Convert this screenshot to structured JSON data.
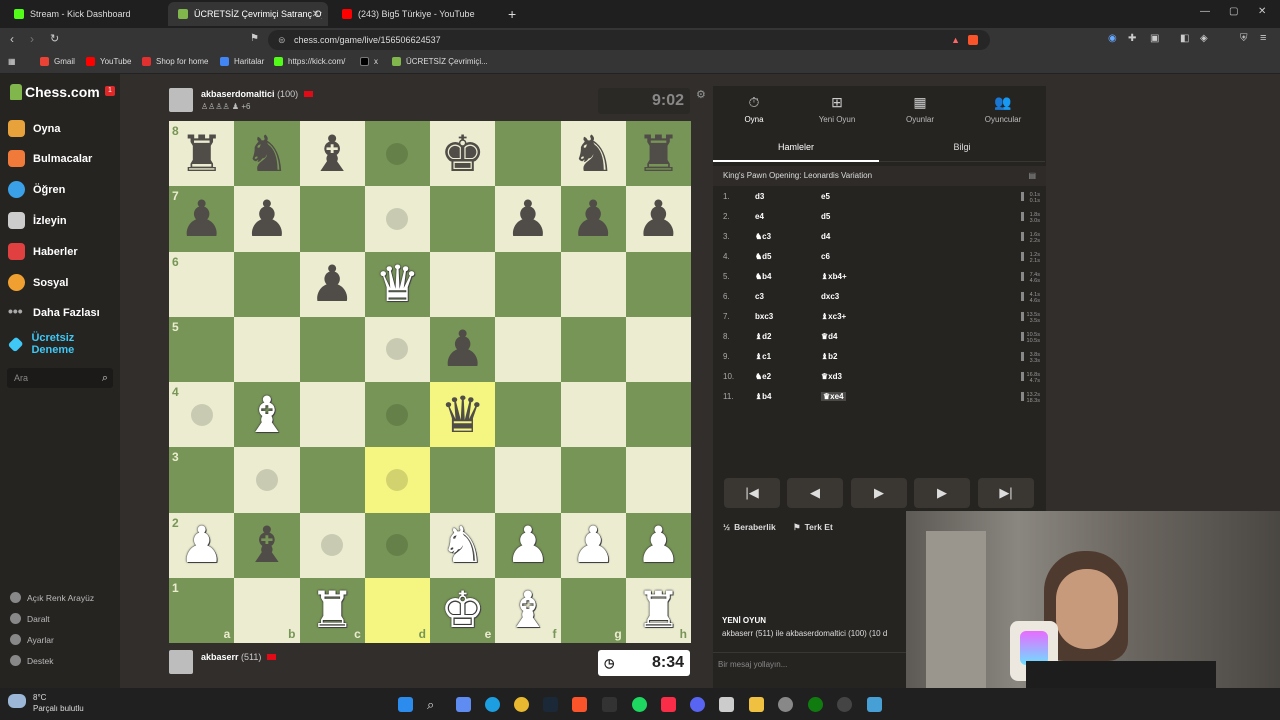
{
  "browser": {
    "tabs": [
      {
        "title": "Stream - Kick Dashboard",
        "color": "#53fc18"
      },
      {
        "title": "ÜCRETSİZ Çevrimiçi Satranç Oyn",
        "color": "#81b64c"
      },
      {
        "title": "(243) Big5 Türkiye - YouTube",
        "color": "#ff0000"
      }
    ],
    "url": "chess.com/game/live/156506624537",
    "bookmarks": [
      {
        "label": "Gmail",
        "color": "#ea4335"
      },
      {
        "label": "YouTube",
        "color": "#ff0000"
      },
      {
        "label": "Shop for home",
        "color": "#e03030"
      },
      {
        "label": "Haritalar",
        "color": "#4285f4"
      },
      {
        "label": "https://kick.com/",
        "color": "#53fc18"
      },
      {
        "label": "x",
        "color": "#000000"
      },
      {
        "label": "ÜCRETSİZ Çevrimiçi...",
        "color": "#81b64c"
      }
    ]
  },
  "sidebar": {
    "logo": "Chess.com",
    "notif_count": "1",
    "items": [
      {
        "label": "Oyna",
        "color": "#e8a23b"
      },
      {
        "label": "Bulmacalar",
        "color": "#f07a3a"
      },
      {
        "label": "Öğren",
        "color": "#3aa0e8"
      },
      {
        "label": "İzleyin",
        "color": "#cccccc"
      },
      {
        "label": "Haberler",
        "color": "#e04040"
      },
      {
        "label": "Sosyal",
        "color": "#f0a030"
      },
      {
        "label": "Daha Fazlası",
        "color": "#aaaaaa"
      },
      {
        "label": "Ücretsiz Deneme",
        "color": "#3fc7f5"
      }
    ],
    "search_placeholder": "Ara",
    "bottom": [
      "Açık Renk Arayüz",
      "Daralt",
      "Ayarlar",
      "Destek"
    ]
  },
  "top_player": {
    "name": "akbaserdomaltici",
    "rating": "(100)",
    "extra": "+6",
    "clock": "9:02"
  },
  "bottom_player": {
    "name": "akbaserr",
    "rating": "(511)",
    "clock": "8:34"
  },
  "board": {
    "files": [
      "a",
      "b",
      "c",
      "d",
      "e",
      "f",
      "g",
      "h"
    ],
    "ranks": [
      "8",
      "7",
      "6",
      "5",
      "4",
      "3",
      "2",
      "1"
    ],
    "position": [
      [
        "br",
        "bn",
        "bb",
        "",
        "bk",
        "",
        "bn",
        "br"
      ],
      [
        "bp",
        "bp",
        "",
        "",
        "",
        "bp",
        "bp",
        "bp"
      ],
      [
        "",
        "",
        "bp",
        "wq",
        "",
        "",
        "",
        ""
      ],
      [
        "",
        "",
        "",
        "",
        "bp",
        "",
        "",
        ""
      ],
      [
        "",
        "wb",
        "",
        "",
        "bq",
        "",
        "",
        ""
      ],
      [
        "",
        "",
        "",
        "",
        "",
        "",
        "",
        ""
      ],
      [
        "wp",
        "bb",
        "",
        "",
        "wn",
        "wp",
        "wp",
        "wp"
      ],
      [
        "",
        "",
        "wr",
        "",
        "wk",
        "wb",
        "",
        "wr"
      ]
    ],
    "hints": [
      "d8",
      "d7",
      "d5",
      "a4",
      "d4",
      "b3",
      "d3",
      "c2",
      "d2"
    ],
    "highlights": [
      "e4",
      "d3",
      "d1"
    ]
  },
  "panel": {
    "tabs": [
      {
        "label": "Oyna",
        "icon": "stopwatch-icon"
      },
      {
        "label": "Yeni Oyun",
        "icon": "plus-icon"
      },
      {
        "label": "Oyunlar",
        "icon": "board-icon"
      },
      {
        "label": "Oyuncular",
        "icon": "players-icon"
      }
    ],
    "subtabs": [
      "Hamleler",
      "Bilgi"
    ],
    "opening": "King's Pawn Opening: Leonardis Variation",
    "moves": [
      {
        "n": "1.",
        "w": "d3",
        "b": "e5",
        "tw": "0.1s",
        "tb": "0.1s"
      },
      {
        "n": "2.",
        "w": "e4",
        "b": "d5",
        "tw": "1.8s",
        "tb": "3.0s"
      },
      {
        "n": "3.",
        "w": "♞c3",
        "b": "d4",
        "tw": "1.6s",
        "tb": "2.2s"
      },
      {
        "n": "4.",
        "w": "♞d5",
        "b": "c6",
        "tw": "1.2s",
        "tb": "2.1s"
      },
      {
        "n": "5.",
        "w": "♞b4",
        "b": "♝xb4+",
        "tw": "7.4s",
        "tb": "4.6s"
      },
      {
        "n": "6.",
        "w": "c3",
        "b": "dxc3",
        "tw": "4.1s",
        "tb": "4.6s"
      },
      {
        "n": "7.",
        "w": "bxc3",
        "b": "♝xc3+",
        "tw": "13.5s",
        "tb": "3.5s"
      },
      {
        "n": "8.",
        "w": "♝d2",
        "b": "♛d4",
        "tw": "10.5s",
        "tb": "10.5s"
      },
      {
        "n": "9.",
        "w": "♝c1",
        "b": "♝b2",
        "tw": "3.8s",
        "tb": "3.3s"
      },
      {
        "n": "10.",
        "w": "♞e2",
        "b": "♛xd3",
        "tw": "16.8s",
        "tb": "4.7s"
      },
      {
        "n": "11.",
        "w": "♝b4",
        "b": "♛xe4",
        "tw": "13.2s",
        "tb": "18.3s"
      }
    ],
    "controls": [
      "|◀",
      "◀",
      "▶",
      "▶",
      "▶|"
    ],
    "draw": "Beraberlik",
    "resign": "Terk Et",
    "new_game_title": "YENİ OYUN",
    "new_game_text": "akbaserr (511) ile akbaserdomaltici (100) (10 d",
    "chat_placeholder": "Bir mesaj yollayın..."
  },
  "weather": {
    "temp": "8°C",
    "desc": "Parçalı bulutlu"
  }
}
